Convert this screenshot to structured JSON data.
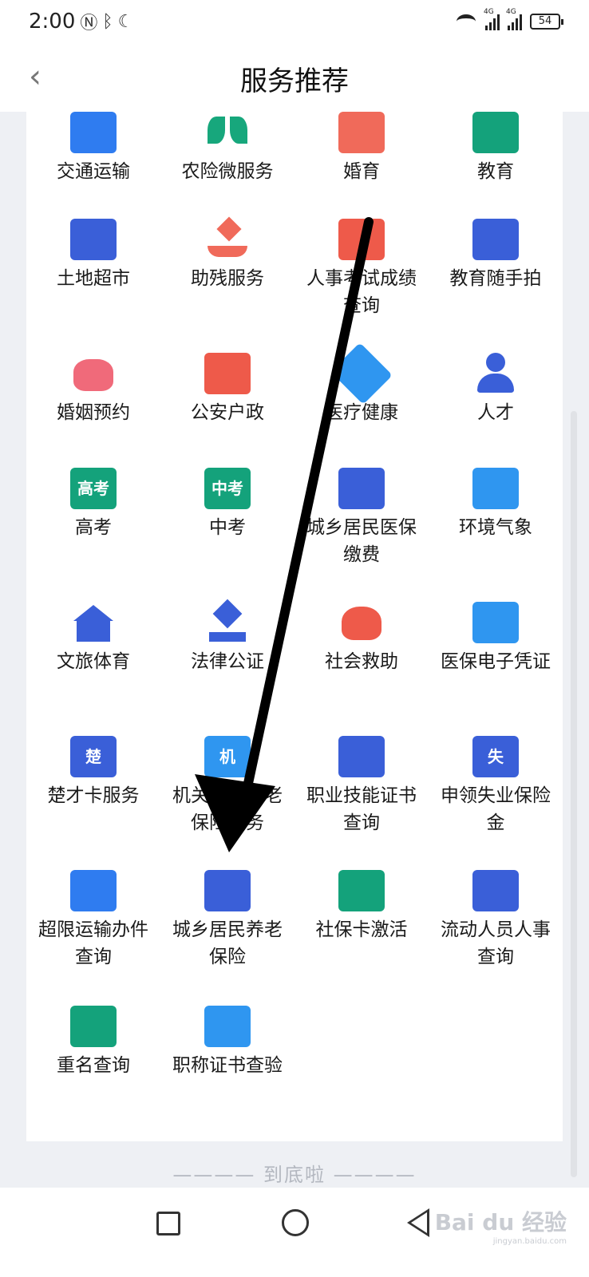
{
  "status_bar": {
    "time": "2:00",
    "network_label": "4G",
    "battery": "54"
  },
  "header": {
    "title": "服务推荐",
    "back_glyph": "‹"
  },
  "services": [
    {
      "label": "交通运输",
      "icon": "bus-icon"
    },
    {
      "label": "农险微服务",
      "icon": "leaf-icon"
    },
    {
      "label": "婚育",
      "icon": "baby-face-icon"
    },
    {
      "label": "教育",
      "icon": "graduation-cap-icon"
    },
    {
      "label": "土地超市",
      "icon": "box-icon"
    },
    {
      "label": "助残服务",
      "icon": "hand-heart-icon"
    },
    {
      "label": "人事考试成绩查询",
      "icon": "exam-book-icon"
    },
    {
      "label": "教育随手拍",
      "icon": "phone-scan-icon"
    },
    {
      "label": "婚姻预约",
      "icon": "couple-heart-icon"
    },
    {
      "label": "公安户政",
      "icon": "police-badge-icon"
    },
    {
      "label": "医疗健康",
      "icon": "medical-cross-icon"
    },
    {
      "label": "人才",
      "icon": "person-icon"
    },
    {
      "label": "高考",
      "icon": "gaokao-icon",
      "icon_text": "高考"
    },
    {
      "label": "中考",
      "icon": "zhongkao-icon",
      "icon_text": "中考"
    },
    {
      "label": "城乡居民医保缴费",
      "icon": "insurance-payment-icon"
    },
    {
      "label": "环境气象",
      "icon": "weather-icon"
    },
    {
      "label": "文旅体育",
      "icon": "temple-icon"
    },
    {
      "label": "法律公证",
      "icon": "gavel-icon"
    },
    {
      "label": "社会救助",
      "icon": "heart-hands-icon"
    },
    {
      "label": "医保电子凭证",
      "icon": "medical-box-icon"
    },
    {
      "label": "楚才卡服务",
      "icon": "chu-card-icon",
      "icon_text": "楚"
    },
    {
      "label": "机关事业养老保险服务",
      "icon": "worker-icon",
      "icon_text": "机"
    },
    {
      "label": "职业技能证书查询",
      "icon": "certificate-icon"
    },
    {
      "label": "申领失业保险金",
      "icon": "tie-icon",
      "icon_text": "失"
    },
    {
      "label": "超限运输办件查询",
      "icon": "bus-front-icon"
    },
    {
      "label": "城乡居民养老保险",
      "icon": "elder-card-icon"
    },
    {
      "label": "社保卡激活",
      "icon": "social-card-icon"
    },
    {
      "label": "流动人员人事查询",
      "icon": "flow-person-icon"
    },
    {
      "label": "重名查询",
      "icon": "checklist-icon"
    },
    {
      "label": "职称证书查验",
      "icon": "title-cert-icon"
    }
  ],
  "footer": {
    "text": "———— 到底啦 ————"
  },
  "watermark": {
    "brand": "Bai du 经验",
    "url": "jingyan.baidu.com"
  }
}
